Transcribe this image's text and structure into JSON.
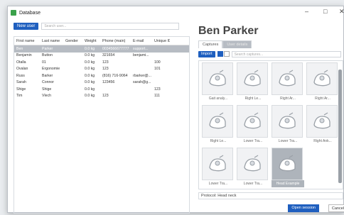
{
  "window": {
    "title": "Database",
    "controls": [
      "–",
      "□",
      "✕"
    ]
  },
  "left": {
    "new_user_label": "New user",
    "search_placeholder": "Search user...",
    "columns": [
      "First name",
      "Last name",
      "Gender",
      "Weight",
      "Phone (main)",
      "E-mail",
      "Unique ID"
    ],
    "rows": [
      {
        "first": "Ben",
        "last": "Parker",
        "gender": "",
        "weight": "0.0 kg",
        "phone": "0034566677777",
        "email": "support...",
        "uid": ""
      },
      {
        "first": "Benjamin",
        "last": "Button",
        "gender": "",
        "weight": "0.0 kg",
        "phone": "321654",
        "email": "benjami...",
        "uid": ""
      },
      {
        "first": "Otalla",
        "last": "01",
        "gender": "",
        "weight": "0.0 kg",
        "phone": "123",
        "email": "",
        "uid": "100"
      },
      {
        "first": "Ovalan",
        "last": "Ergonomie",
        "gender": "",
        "weight": "0.0 kg",
        "phone": "123",
        "email": "",
        "uid": "101"
      },
      {
        "first": "Russ",
        "last": "Barker",
        "gender": "",
        "weight": "0.0 kg",
        "phone": "(816) 716-9064",
        "email": "rbarker@...",
        "uid": ""
      },
      {
        "first": "Sarah",
        "last": "Connor",
        "gender": "",
        "weight": "0.0 kg",
        "phone": "123456",
        "email": "sarah@g...",
        "uid": ""
      },
      {
        "first": "Shige",
        "last": "Shige",
        "gender": "",
        "weight": "0.0 kg",
        "phone": "",
        "email": "",
        "uid": "123"
      },
      {
        "first": "Tim",
        "last": "Vlech",
        "gender": "",
        "weight": "0.0 kg",
        "phone": "123",
        "email": "",
        "uid": "111"
      }
    ]
  },
  "right": {
    "user_name": "Ben Parker",
    "tabs": [
      "Captures",
      "User details"
    ],
    "import_label": "Import",
    "capture_search_placeholder": "Search captures...",
    "captures": [
      "Gait analy...",
      "Right Le...",
      "Right Ar...",
      "Right Ar...",
      "Right Le...",
      "Lower Tra...",
      "Lower Tra...",
      "Right Ank...",
      "Lower Tra...",
      "Lower Tra...",
      "Head Example"
    ],
    "protocol_text": "Protocol: Head neck",
    "open_session_label": "Open session",
    "cancel_label": "Cancel"
  }
}
